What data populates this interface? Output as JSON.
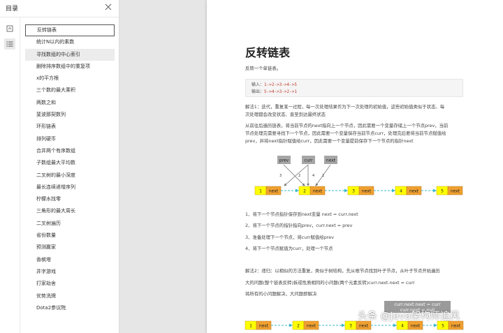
{
  "sidebar": {
    "title": "目录",
    "tools": [
      {
        "icon": "page-thumbnail-icon"
      },
      {
        "icon": "outline-list-icon"
      }
    ],
    "items": [
      {
        "label": "反转链表",
        "selected": true
      },
      {
        "label": "统计N以内的素数"
      },
      {
        "label": "寻找数组的中心索引",
        "hover": true
      },
      {
        "label": "删除排序数组中的重复项"
      },
      {
        "label": "x的平方根"
      },
      {
        "label": "三个数的最大乘积"
      },
      {
        "label": "两数之和"
      },
      {
        "label": "斐波那契数列"
      },
      {
        "label": "环形链表"
      },
      {
        "label": "排列硬币"
      },
      {
        "label": "合并两个有序数组"
      },
      {
        "label": "子数组最大平均数"
      },
      {
        "label": "二叉树的最小深度"
      },
      {
        "label": "最长连续递增序列"
      },
      {
        "label": "柠檬水找零"
      },
      {
        "label": "三角形的最大周长"
      },
      {
        "label": "二叉树遍历"
      },
      {
        "label": "省份数量"
      },
      {
        "label": "预测赢家"
      },
      {
        "label": "香槟塔"
      },
      {
        "label": "井字游戏"
      },
      {
        "label": "打家劫舍"
      },
      {
        "label": "优势洗牌"
      },
      {
        "label": "Dota2参议院"
      }
    ]
  },
  "document": {
    "title": "反转链表",
    "intro": "反转一个单链表。",
    "code": {
      "input_label": "输入：",
      "input_value": "1->2->3->4->5",
      "output_label": "输出：",
      "output_value": "5->4->3->2->1"
    },
    "solution1_line1": "解法1：迭代，重复某一过程，每一次处理结果作为下一次处理的初始值，这些初始值类似于状态、每",
    "solution1_line2": "次处理都会改变状态、直至到达最终状态",
    "para2_line1": "从前往后遍历链表，将当前节点的next指向上一个节点，因此需要一个变量存储上一个节点prev，当前",
    "para2_line2": "节点处理完需要寻找下一个节点，因此需要一个变量保存当前节点curr，处理完后要将当前节点赋值给",
    "para2_line3": "prev，并将next指针赋值给curr，因此需要一个变量提前保存下一个节点的指针next",
    "steps": [
      "1、将下一个节点指针保存到next变量 next = curr.next",
      "2、将下一个节点的指针指向prev，curr.next = prev",
      "3、准备处理下一个节点，将curr赋值给prev",
      "4、将下一个节点赋值为curr，处理一个节点"
    ],
    "solution2_line1": "解法2：递归：以相似的方法重复，类似于树结构，先从根节点找到叶子节点，从叶子节点开始遍历",
    "solution2_line2": "大的问题(整个链表反转)拆成性质相同的小问题(两个元素反转)curr.next.next = curr",
    "solution2_line3": "将所有的小问题解决，大问题即解决"
  },
  "diagram1": {
    "pointer_labels": [
      "prev",
      "curr",
      "next"
    ],
    "arrow_numbers": [
      "3",
      "2",
      "4",
      "1"
    ],
    "nodes": [
      "1",
      "2",
      "3",
      "4",
      "5"
    ],
    "next_label": "next"
  },
  "diagram2": {
    "nodes": [
      "1",
      "2",
      "3",
      "4",
      "5"
    ],
    "next_label": "next"
  },
  "tooltip": {
    "line1": "curr.next.next = curr",
    "line2": "curr.next = null"
  },
  "watermark": "头条 @Java架构师追风",
  "colors": {
    "node_value": "#ffff00",
    "node_next": "#f0a030",
    "arrow": "#3ab8c8",
    "pointer_box": "#a6a6a6"
  }
}
